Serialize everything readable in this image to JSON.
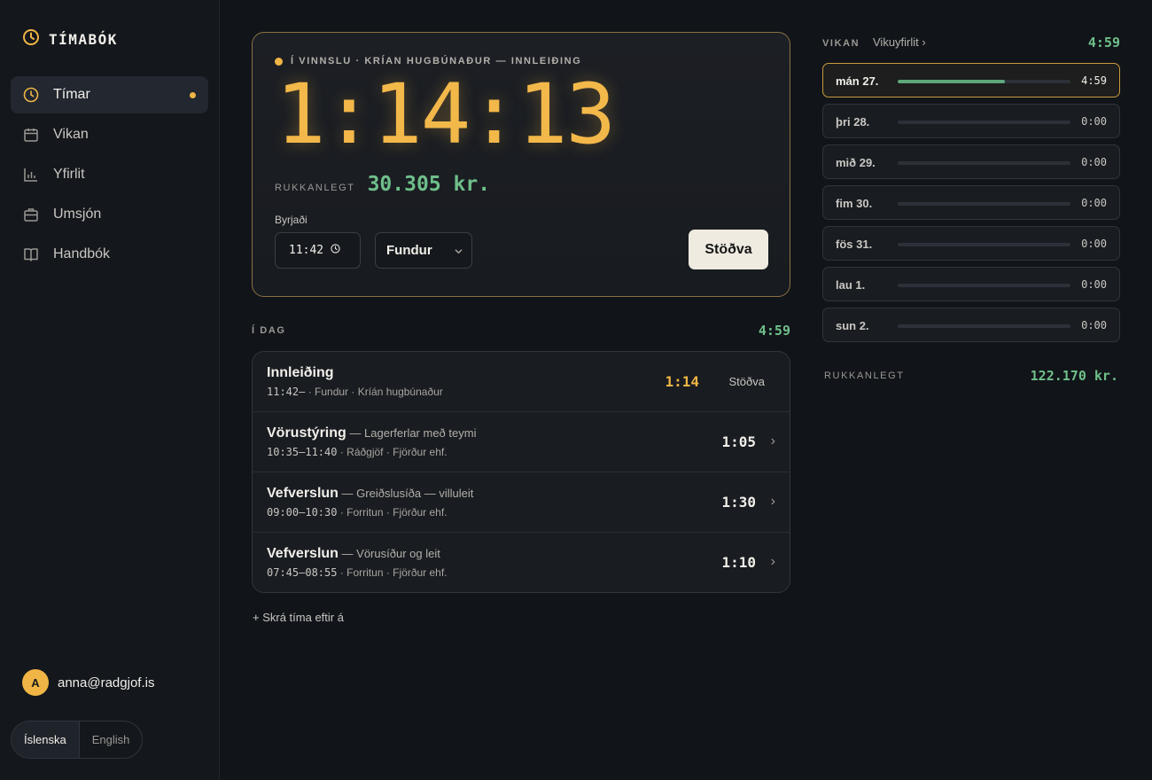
{
  "app": {
    "name": "TÍMABÓK"
  },
  "nav": [
    {
      "label": "Tímar",
      "active": true,
      "icon": "clock-icon"
    },
    {
      "label": "Vikan",
      "active": false,
      "icon": "calendar-icon"
    },
    {
      "label": "Yfirlit",
      "active": false,
      "icon": "bar-chart-icon"
    },
    {
      "label": "Umsjón",
      "active": false,
      "icon": "briefcase-icon"
    },
    {
      "label": "Handbók",
      "active": false,
      "icon": "book-icon"
    }
  ],
  "user": {
    "initial": "A",
    "email": "anna@radgjof.is"
  },
  "lang": {
    "options": [
      "Íslenska",
      "English"
    ],
    "selected": "Íslenska"
  },
  "timer": {
    "status": "Í VINNSLU · KRÍAN HUGBÚNAÐUR — INNLEIÐING",
    "elapsed": "1:14:13",
    "billable_label": "RUKKANLEGT",
    "billable_amount": "30.305 kr.",
    "started_label": "Byrjaði",
    "started_value": "11:42",
    "category": "Fundur",
    "stop_label": "Stöðva"
  },
  "today": {
    "label": "Í DAG",
    "total": "4:59",
    "entries": [
      {
        "title": "Innleiðing",
        "subtitle": "",
        "time": "11:42–",
        "meta": " · Fundur · Kríán hugbúnaður",
        "duration": "1:14",
        "running": true,
        "action": "Stöðva"
      },
      {
        "title": "Vörustýring",
        "subtitle": " — Lagerferlar með teymi",
        "time": "10:35–11:40",
        "meta": " · Ráðgjöf · Fjörður ehf.",
        "duration": "1:05",
        "running": false
      },
      {
        "title": "Vefverslun",
        "subtitle": " — Greiðslusíða — villuleit",
        "time": "09:00–10:30",
        "meta": " · Forritun · Fjörður ehf.",
        "duration": "1:30",
        "running": false
      },
      {
        "title": "Vefverslun",
        "subtitle": " — Vörusíður og leit",
        "time": "07:45–08:55",
        "meta": " · Forritun · Fjörður ehf.",
        "duration": "1:10",
        "running": false
      }
    ],
    "add_later": "+ Skrá tíma eftir á"
  },
  "week": {
    "label": "VIKAN",
    "overview_link": "Vikuyfirlit ›",
    "total": "4:59",
    "days": [
      {
        "name": "mán 27.",
        "time": "4:59",
        "fill": 0.62,
        "active": true
      },
      {
        "name": "þri 28.",
        "time": "0:00",
        "fill": 0,
        "active": false
      },
      {
        "name": "mið 29.",
        "time": "0:00",
        "fill": 0,
        "active": false
      },
      {
        "name": "fim 30.",
        "time": "0:00",
        "fill": 0,
        "active": false
      },
      {
        "name": "fös 31.",
        "time": "0:00",
        "fill": 0,
        "active": false
      },
      {
        "name": "lau 1.",
        "time": "0:00",
        "fill": 0,
        "active": false
      },
      {
        "name": "sun 2.",
        "time": "0:00",
        "fill": 0,
        "active": false
      }
    ],
    "billable_label": "RUKKANLEGT",
    "billable_amount": "122.170 kr."
  },
  "colors": {
    "accent": "#f0b544",
    "green": "#6fbf8a",
    "bg": "#111419"
  }
}
